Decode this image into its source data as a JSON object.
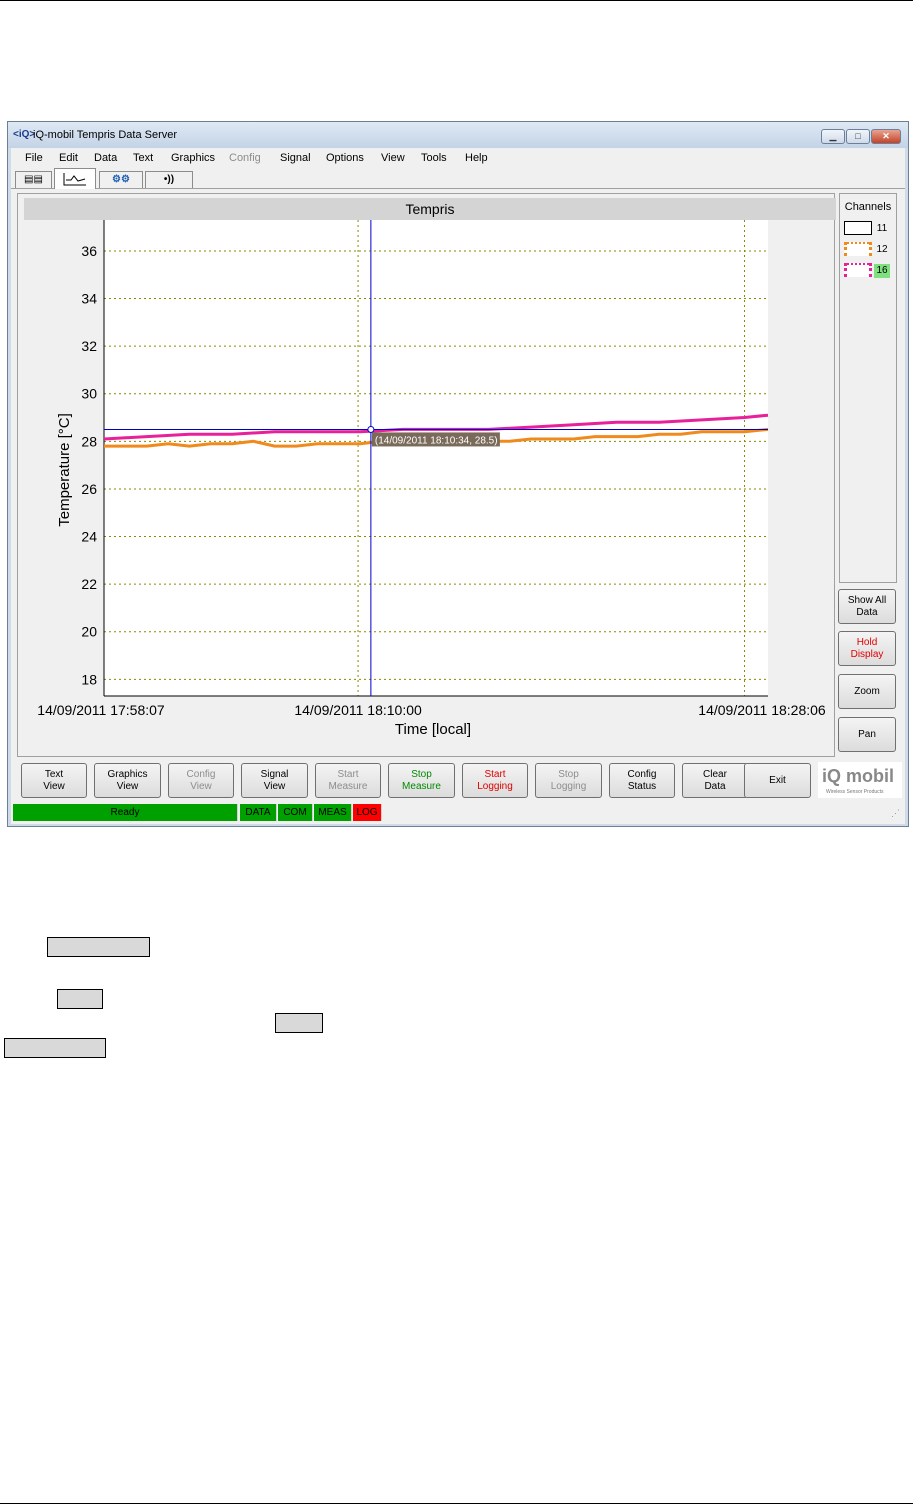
{
  "window": {
    "title": "iQ-mobil Tempris Data Server",
    "controls": [
      "minimize",
      "maximize",
      "close"
    ]
  },
  "menu": [
    {
      "label": "File",
      "enabled": true
    },
    {
      "label": "Edit",
      "enabled": true
    },
    {
      "label": "Data",
      "enabled": true
    },
    {
      "label": "Text",
      "enabled": true
    },
    {
      "label": "Graphics",
      "enabled": true
    },
    {
      "label": "Config",
      "enabled": false
    },
    {
      "label": "Signal",
      "enabled": true
    },
    {
      "label": "Options",
      "enabled": true
    },
    {
      "label": "View",
      "enabled": true
    },
    {
      "label": "Tools",
      "enabled": true
    },
    {
      "label": "Help",
      "enabled": true
    }
  ],
  "tabs": [
    {
      "icon": "table-icon",
      "active": false
    },
    {
      "icon": "graph-icon",
      "active": true
    },
    {
      "icon": "device-icon",
      "active": false
    },
    {
      "icon": "wireless-icon",
      "active": false
    }
  ],
  "chart_data": {
    "type": "line",
    "title": "Tempris",
    "xlabel": "Time [local]",
    "ylabel": "Temperature [°C]",
    "ylim": [
      17.3,
      37.3
    ],
    "yticks": [
      18,
      20,
      22,
      24,
      26,
      28,
      30,
      32,
      34,
      36
    ],
    "x_tick_labels": [
      "14/09/2011 17:58:07",
      "14/09/2011 18:10:00",
      "14/09/2011 18:28:06"
    ],
    "x_tick_minutes": [
      0,
      11.9,
      30
    ],
    "xlim_minutes": [
      0,
      31.1
    ],
    "grid": true,
    "series": [
      {
        "name": "12",
        "color": "#f08a1c",
        "x": [
          0,
          1,
          2,
          3,
          4,
          5,
          6,
          7,
          8,
          9,
          10,
          11,
          12,
          13,
          14,
          15,
          16,
          17,
          18,
          19,
          20,
          21,
          22,
          23,
          24,
          25,
          26,
          27,
          28,
          29,
          30,
          31.1
        ],
        "y": [
          27.8,
          27.8,
          27.8,
          27.9,
          27.8,
          27.9,
          27.9,
          28.0,
          27.8,
          27.8,
          27.9,
          27.9,
          27.9,
          28.0,
          27.9,
          27.9,
          28.0,
          28.0,
          28.0,
          28.0,
          28.1,
          28.1,
          28.1,
          28.2,
          28.2,
          28.2,
          28.3,
          28.3,
          28.4,
          28.4,
          28.4,
          28.5
        ]
      },
      {
        "name": "16",
        "color": "#e8209a",
        "x": [
          0,
          2,
          4,
          6,
          8,
          10,
          12,
          14,
          16,
          18,
          20,
          22,
          24,
          26,
          28,
          30,
          31.1
        ],
        "y": [
          28.1,
          28.2,
          28.3,
          28.3,
          28.4,
          28.4,
          28.4,
          28.5,
          28.5,
          28.5,
          28.6,
          28.7,
          28.8,
          28.8,
          28.9,
          29.0,
          29.1
        ]
      }
    ],
    "cursor": {
      "x_minutes": 12.5,
      "y": 28.5,
      "color": "#0000cc",
      "label": "(14/09/2011 18:10:34, 28.5)"
    }
  },
  "channels": {
    "title": "Channels",
    "items": [
      {
        "id": "11",
        "color": "#000000",
        "highlight": false
      },
      {
        "id": "12",
        "color": "#f08a1c",
        "highlight": false
      },
      {
        "id": "16",
        "color": "#e8209a",
        "highlight": true
      }
    ]
  },
  "side_buttons": [
    {
      "label": "Show All\nData",
      "style": "normal"
    },
    {
      "label": "Hold\nDisplay",
      "style": "red"
    },
    {
      "label": "Zoom",
      "style": "normal"
    },
    {
      "label": "Pan",
      "style": "normal"
    }
  ],
  "bottom_buttons": [
    {
      "label": "Text\nView",
      "style": "normal"
    },
    {
      "label": "Graphics\nView",
      "style": "normal"
    },
    {
      "label": "Config\nView",
      "style": "disabled"
    },
    {
      "label": "Signal\nView",
      "style": "normal"
    },
    {
      "label": "Start\nMeasure",
      "style": "disabled"
    },
    {
      "label": "Stop\nMeasure",
      "style": "green"
    },
    {
      "label": "Start\nLogging",
      "style": "red"
    },
    {
      "label": "Stop\nLogging",
      "style": "disabled"
    },
    {
      "label": "Config\nStatus",
      "style": "normal"
    },
    {
      "label": "Clear\nData",
      "style": "normal"
    },
    {
      "label": "Exit",
      "style": "normal"
    }
  ],
  "logo": {
    "text": "iQ mobil",
    "subtitle": "Wireless Sensor Products"
  },
  "statusbar": [
    {
      "label": "Ready",
      "color": "#00a000"
    },
    {
      "label": "DATA",
      "color": "#00a000"
    },
    {
      "label": "COM",
      "color": "#00a000"
    },
    {
      "label": "MEAS",
      "color": "#00a000"
    },
    {
      "label": "LOG",
      "color": "#ff0000"
    }
  ]
}
